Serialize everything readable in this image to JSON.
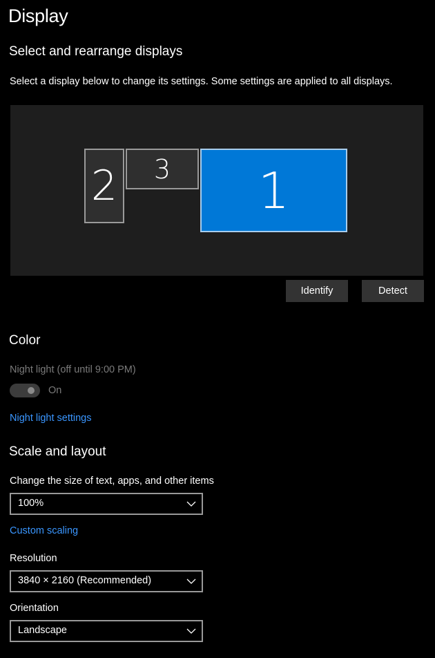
{
  "page": {
    "title": "Display"
  },
  "arrange": {
    "heading": "Select and rearrange displays",
    "description": "Select a display below to change its settings. Some settings are applied to all displays.",
    "monitors": [
      {
        "number": "1",
        "selected": true
      },
      {
        "number": "2",
        "selected": false
      },
      {
        "number": "3",
        "selected": false
      }
    ],
    "identify_label": "Identify",
    "detect_label": "Detect"
  },
  "color": {
    "heading": "Color",
    "night_light_label": "Night light (off until 9:00 PM)",
    "toggle_state": "On",
    "toggle_enabled": false,
    "night_light_settings_link": "Night light settings"
  },
  "scale_layout": {
    "heading": "Scale and layout",
    "scale_label": "Change the size of text, apps, and other items",
    "scale_value": "100%",
    "custom_scaling_link": "Custom scaling",
    "resolution_label": "Resolution",
    "resolution_value": "3840 × 2160 (Recommended)",
    "orientation_label": "Orientation",
    "orientation_value": "Landscape"
  },
  "icons": {
    "dropdown": "chevron-down-icon"
  },
  "colors": {
    "background": "#000000",
    "accent": "#0078d7",
    "link": "#3a96ff",
    "canvas": "#1e1e1e",
    "button": "#333333",
    "disabled_text": "#7a7a7a"
  }
}
